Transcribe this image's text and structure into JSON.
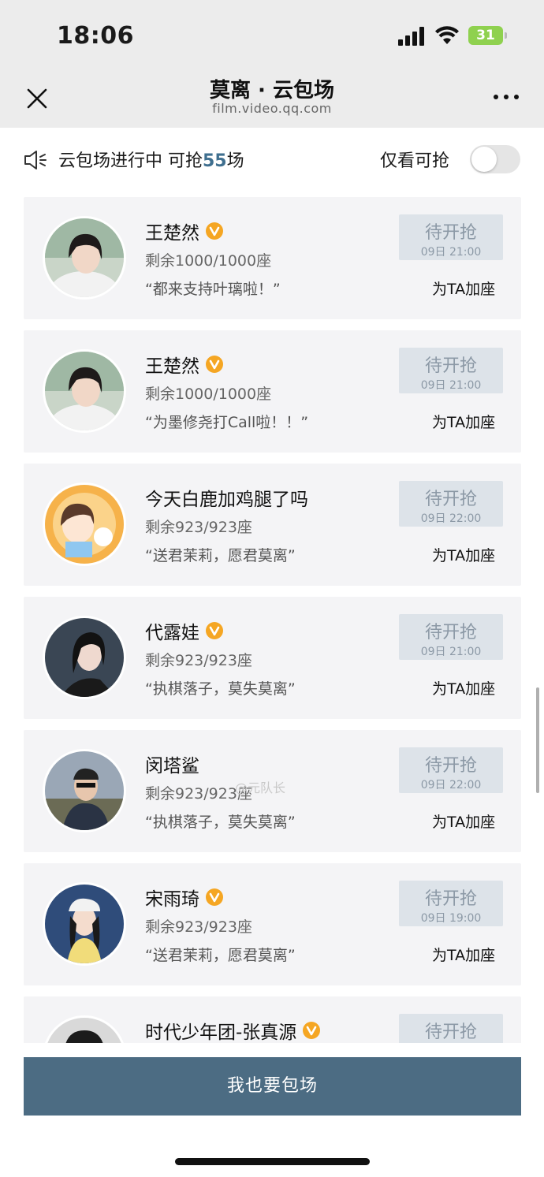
{
  "status_bar": {
    "time": "18:06",
    "battery": "31"
  },
  "nav": {
    "title": "莫离 · 云包场",
    "subtitle": "film.video.qq.com"
  },
  "info": {
    "prefix": "云包场进行中 可抢",
    "count": "55",
    "suffix": "场",
    "filter_label": "仅看可抢",
    "filter_on": false
  },
  "cards": [
    {
      "name": "王楚然",
      "verified": true,
      "seats": "剩余1000/1000座",
      "slogan": "“都来支持叶璃啦！”",
      "button_label": "待开抢",
      "button_time": "09日 21:00",
      "boost": "为TA加座"
    },
    {
      "name": "王楚然",
      "verified": true,
      "seats": "剩余1000/1000座",
      "slogan": "“为墨修尧打Call啦！！”",
      "button_label": "待开抢",
      "button_time": "09日 21:00",
      "boost": "为TA加座"
    },
    {
      "name": "今天白鹿加鸡腿了吗",
      "verified": false,
      "seats": "剩余923/923座",
      "slogan": "“送君茉莉，愿君莫离”",
      "button_label": "待开抢",
      "button_time": "09日 22:00",
      "boost": "为TA加座"
    },
    {
      "name": "代露娃",
      "verified": true,
      "seats": "剩余923/923座",
      "slogan": "“执棋落子，莫失莫离”",
      "button_label": "待开抢",
      "button_time": "09日 21:00",
      "boost": "为TA加座"
    },
    {
      "name": "闵塔鲨",
      "verified": false,
      "seats": "剩余923/923座",
      "slogan": "“执棋落子，莫失莫离”",
      "button_label": "待开抢",
      "button_time": "09日 22:00",
      "boost": "为TA加座"
    },
    {
      "name": "宋雨琦",
      "verified": true,
      "seats": "剩余923/923座",
      "slogan": "“送君茉莉，愿君莫离”",
      "button_label": "待开抢",
      "button_time": "09日 19:00",
      "boost": "为TA加座"
    },
    {
      "name": "时代少年团-张真源",
      "verified": true,
      "seats": "",
      "slogan": "",
      "button_label": "待开抢",
      "button_time": "",
      "boost": ""
    }
  ],
  "watermark": "@元队长",
  "cta_label": "我也要包场",
  "colors": {
    "accent": "#4c6c83",
    "highlight": "#3f6f8f",
    "verified_badge": "#f5a623",
    "button_bg": "#dde3e9"
  },
  "icons": {
    "close": "close-icon",
    "more": "more-icon",
    "speaker": "speaker-icon",
    "verified": "verified-v-icon"
  }
}
